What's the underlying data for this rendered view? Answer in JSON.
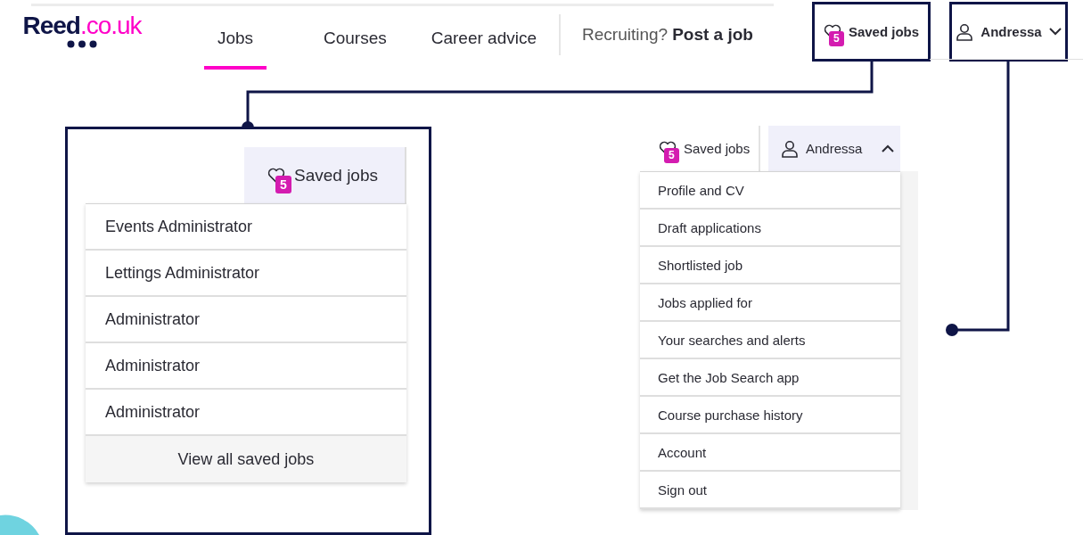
{
  "header": {
    "logo": {
      "brand": "Reed",
      "suffix": ".co.uk"
    },
    "nav": [
      {
        "label": "Jobs",
        "selected": true
      },
      {
        "label": "Courses",
        "selected": false
      },
      {
        "label": "Career advice",
        "selected": false
      }
    ],
    "recruiting": {
      "prefix": "Recruiting?",
      "link": "Post a job"
    },
    "saved_jobs": {
      "label": "Saved jobs",
      "count": "5",
      "expanded": false
    },
    "account": {
      "name": "Andressa",
      "expanded": false
    }
  },
  "saved_jobs_callout": {
    "button": {
      "label": "Saved jobs",
      "count": "5",
      "expanded": true
    },
    "items": [
      "Events Administrator",
      "Lettings Administrator",
      "Administrator",
      "Administrator",
      "Administrator"
    ],
    "footer": "View all saved jobs"
  },
  "account_callout": {
    "saved_jobs": {
      "label": "Saved jobs",
      "count": "5",
      "expanded": false
    },
    "account": {
      "name": "Andressa",
      "expanded": true
    },
    "items": [
      "Profile and CV",
      "Draft applications",
      "Shortlisted job",
      "Jobs applied for",
      "Your searches and alerts",
      "Get the Job Search app",
      "Course purchase history",
      "Account",
      "Sign out"
    ]
  }
}
